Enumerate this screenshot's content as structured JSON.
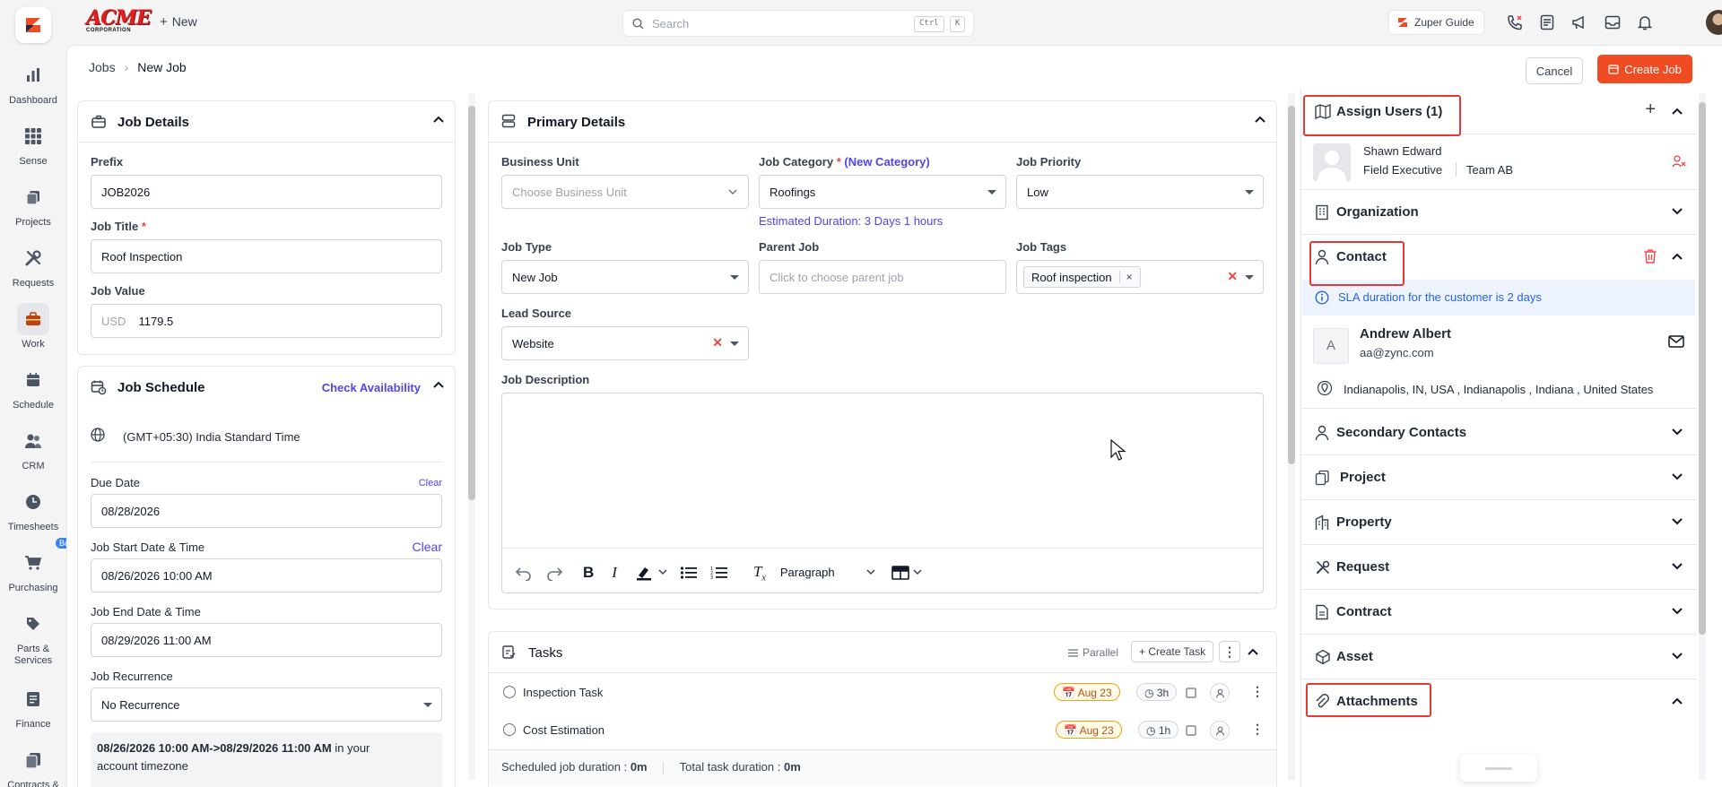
{
  "app": {
    "logo_text": "ACME",
    "logo_sub": "CORPORATION",
    "new_label": "New",
    "search_placeholder": "Search",
    "kbd_ctrl": "Ctrl",
    "kbd_k": "K",
    "guide_label": "Zuper Guide"
  },
  "sidebar": {
    "items": [
      {
        "label": "Dashboard",
        "icon": "bar-chart-icon"
      },
      {
        "label": "Sense",
        "icon": "grid-icon"
      },
      {
        "label": "Projects",
        "icon": "projects-icon"
      },
      {
        "label": "Requests",
        "icon": "tools-icon"
      },
      {
        "label": "Work",
        "icon": "briefcase-icon"
      },
      {
        "label": "Schedule",
        "icon": "calendar-icon"
      },
      {
        "label": "CRM",
        "icon": "people-icon"
      },
      {
        "label": "Timesheets",
        "icon": "clock-icon"
      },
      {
        "label": "Purchasing",
        "icon": "cart-icon",
        "badge": "Beta"
      },
      {
        "label": "Parts & Services",
        "icon": "tag-icon"
      },
      {
        "label": "Finance",
        "icon": "document-icon"
      },
      {
        "label": "Contracts &",
        "icon": "contracts-icon"
      }
    ]
  },
  "header": {
    "breadcrumb": [
      "Jobs",
      "New Job"
    ],
    "cancel_label": "Cancel",
    "create_label": "Create Job"
  },
  "job_details": {
    "title": "Job Details",
    "prefix_label": "Prefix",
    "prefix_value": "JOB2026",
    "title_label": "Job Title",
    "title_value": "Roof Inspection",
    "value_label": "Job Value",
    "currency": "USD",
    "value_value": "1179.5"
  },
  "job_schedule": {
    "title": "Job Schedule",
    "check_availability": "Check Availability",
    "timezone": "(GMT+05:30) India Standard Time",
    "due_label": "Due Date",
    "due_clear": "Clear",
    "due_value": "08/28/2026",
    "start_label": "Job Start Date & Time",
    "start_clear": "Clear",
    "start_value": "08/26/2026 10:00 AM",
    "end_label": "Job End Date & Time",
    "end_value": "08/29/2026 11:00 AM",
    "recurrence_label": "Job Recurrence",
    "recurrence_value": "No Recurrence",
    "summary_bold": "08/26/2026 10:00 AM->08/29/2026 11:00 AM",
    "summary_rest": " in your",
    "summary_line2": "account timezone"
  },
  "primary": {
    "title": "Primary Details",
    "business_unit_label": "Business Unit",
    "business_unit_placeholder": "Choose Business Unit",
    "category_label": "Job Category",
    "new_category": "(New Category)",
    "category_value": "Roofings",
    "estimated": "Estimated Duration: 3 Days 1 hours",
    "priority_label": "Job Priority",
    "priority_value": "Low",
    "type_label": "Job Type",
    "type_value": "New Job",
    "parent_label": "Parent Job",
    "parent_placeholder": "Click to choose parent job",
    "tags_label": "Job Tags",
    "tag_value": "Roof inspection",
    "lead_label": "Lead Source",
    "lead_value": "Website",
    "desc_label": "Job Description",
    "paragraph": "Paragraph"
  },
  "tasks": {
    "title": "Tasks",
    "parallel": "Parallel",
    "create_task": "Create Task",
    "items": [
      {
        "name": "Inspection Task",
        "date": "Aug 23",
        "duration": "3h"
      },
      {
        "name": "Cost Estimation",
        "date": "Aug 23",
        "duration": "1h"
      }
    ],
    "scheduled_label": "Scheduled job duration : ",
    "scheduled_value": "0m",
    "total_label": "Total task duration : ",
    "total_value": "0m"
  },
  "right": {
    "assign_title": "Assign Users (1)",
    "user_name": "Shawn Edward",
    "user_role": "Field Executive",
    "user_team": "Team AB",
    "organization": "Organization",
    "contact": "Contact",
    "sla": "SLA duration for the customer is 2 days",
    "contact_initial": "A",
    "contact_name": "Andrew Albert",
    "contact_email": "aa@zync.com",
    "address": "Indianapolis, IN, USA , Indianapolis , Indiana , United States",
    "secondary": "Secondary Contacts",
    "project": "Project",
    "property": "Property",
    "request": "Request",
    "contract": "Contract",
    "asset": "Asset",
    "attachments": "Attachments"
  },
  "colors": {
    "accent": "#ef4c23",
    "link": "#4f46e5",
    "highlight": "#e53935"
  }
}
